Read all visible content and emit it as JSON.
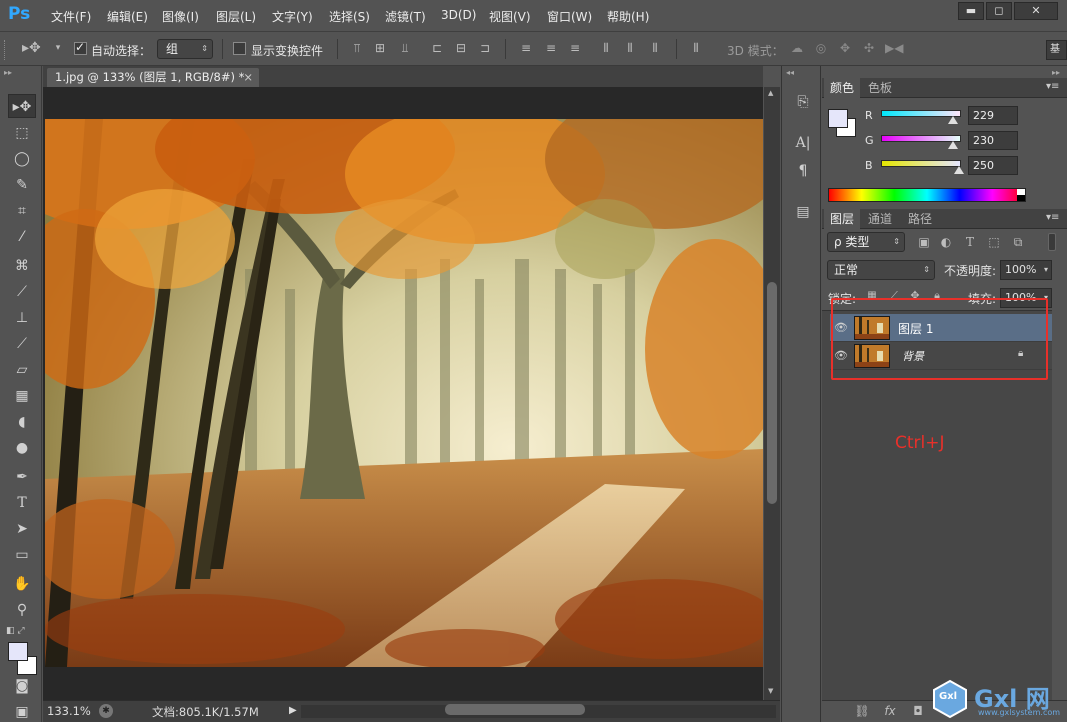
{
  "app": {
    "logo": "Ps"
  },
  "menu": [
    "文件(F)",
    "编辑(E)",
    "图像(I)",
    "图层(L)",
    "文字(Y)",
    "选择(S)",
    "滤镜(T)",
    "3D(D)",
    "视图(V)",
    "窗口(W)",
    "帮助(H)"
  ],
  "window_controls": {
    "minimize": "▬",
    "maximize": "◻",
    "close": "✕"
  },
  "options": {
    "auto_select_label": "自动选择：",
    "auto_select_checked": true,
    "auto_select_target": "组",
    "show_transform_label": "显示变换控件",
    "show_transform_checked": false,
    "mode_3d_label": "3D 模式："
  },
  "document": {
    "tab_title": "1.jpg @ 133% (图层 1, RGB/8#) *",
    "tab_close": "×",
    "zoom": "133.1%",
    "doc_info": "文档:805.1K/1.57M"
  },
  "color_panel": {
    "tabs": [
      "颜色",
      "色板"
    ],
    "active_tab": 0,
    "r_label": "R",
    "g_label": "G",
    "b_label": "B",
    "r": "229",
    "g": "230",
    "b": "250",
    "r_fraction": 0.898,
    "g_fraction": 0.902,
    "b_fraction": 0.98,
    "foreground_color": "#e5e6fa",
    "background_color": "#ffffff"
  },
  "layers_panel": {
    "tabs": [
      "图层",
      "通道",
      "路径"
    ],
    "active_tab": 0,
    "filter_label": "ρ 类型",
    "blend_mode": "正常",
    "opacity_label": "不透明度:",
    "opacity_value": "100%",
    "lock_label": "锁定:",
    "fill_label": "填充:",
    "fill_value": "100%",
    "layers": [
      {
        "name": "图层 1",
        "selected": true,
        "locked": false
      },
      {
        "name": "背景",
        "selected": false,
        "locked": true
      }
    ]
  },
  "annotation": {
    "text": "Ctrl+J",
    "color": "#e8302a"
  },
  "watermark": {
    "logo": "Gxl",
    "brand": "网",
    "url": "www.gxlsystem.com"
  }
}
